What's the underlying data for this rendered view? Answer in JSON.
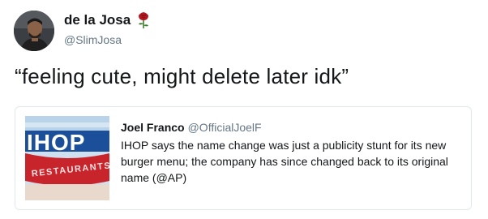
{
  "tweet": {
    "author_name": "de la Josa",
    "author_handle": "@SlimJosa",
    "text": "“feeling cute, might delete later idk”",
    "name_emoji_icon": "rose-icon"
  },
  "quoted_tweet": {
    "author_name": "Joel Franco",
    "author_handle": "@OfficialJoelF",
    "text": "IHOP says the name change was just a publicity stunt for its new burger menu; the company has since changed back to its original name (@AP)",
    "image_sign_text": "IHOP",
    "image_sub_text": "RESTAURANTS"
  },
  "colors": {
    "name_text": "#14171a",
    "handle_text": "#657786",
    "card_border": "#e1e8ed",
    "sign_blue": "#1c4f99",
    "sign_red": "#c8242b",
    "rose_red": "#b3161f",
    "stem_green": "#3a7d2c"
  }
}
